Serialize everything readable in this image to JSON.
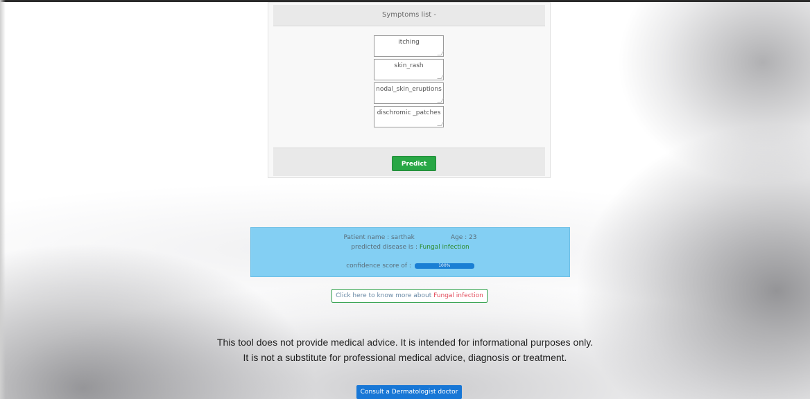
{
  "symptoms_card": {
    "header": "Symptoms list -",
    "symptoms": [
      "itching",
      "skin_rash",
      "nodal_skin_eruptions",
      "dischromic _patches"
    ],
    "predict_label": "Predict"
  },
  "result": {
    "patient_label": "Patient name : sarthak",
    "age_label": "Age : 23",
    "predicted_prefix": "predicted disease is : ",
    "predicted_disease": "Fungal infection",
    "confidence_label": "confidence score of :",
    "confidence_text": "100%",
    "confidence_value": 1.0
  },
  "know_more": {
    "prefix": "Click here to know more about ",
    "disease": "Fungal infection"
  },
  "disclaimer": {
    "line1": "This tool does not provide medical advice. It is intended for informational purposes only.",
    "line2": "It is not a substitute for professional medical advice, diagnosis or treatment."
  },
  "consult_label": "Consult a Dermatologist doctor",
  "colors": {
    "predict_button": "#28a745",
    "result_background": "#83cff3",
    "consult_button": "#1877d6",
    "disease_text": "#2e8b2e"
  }
}
